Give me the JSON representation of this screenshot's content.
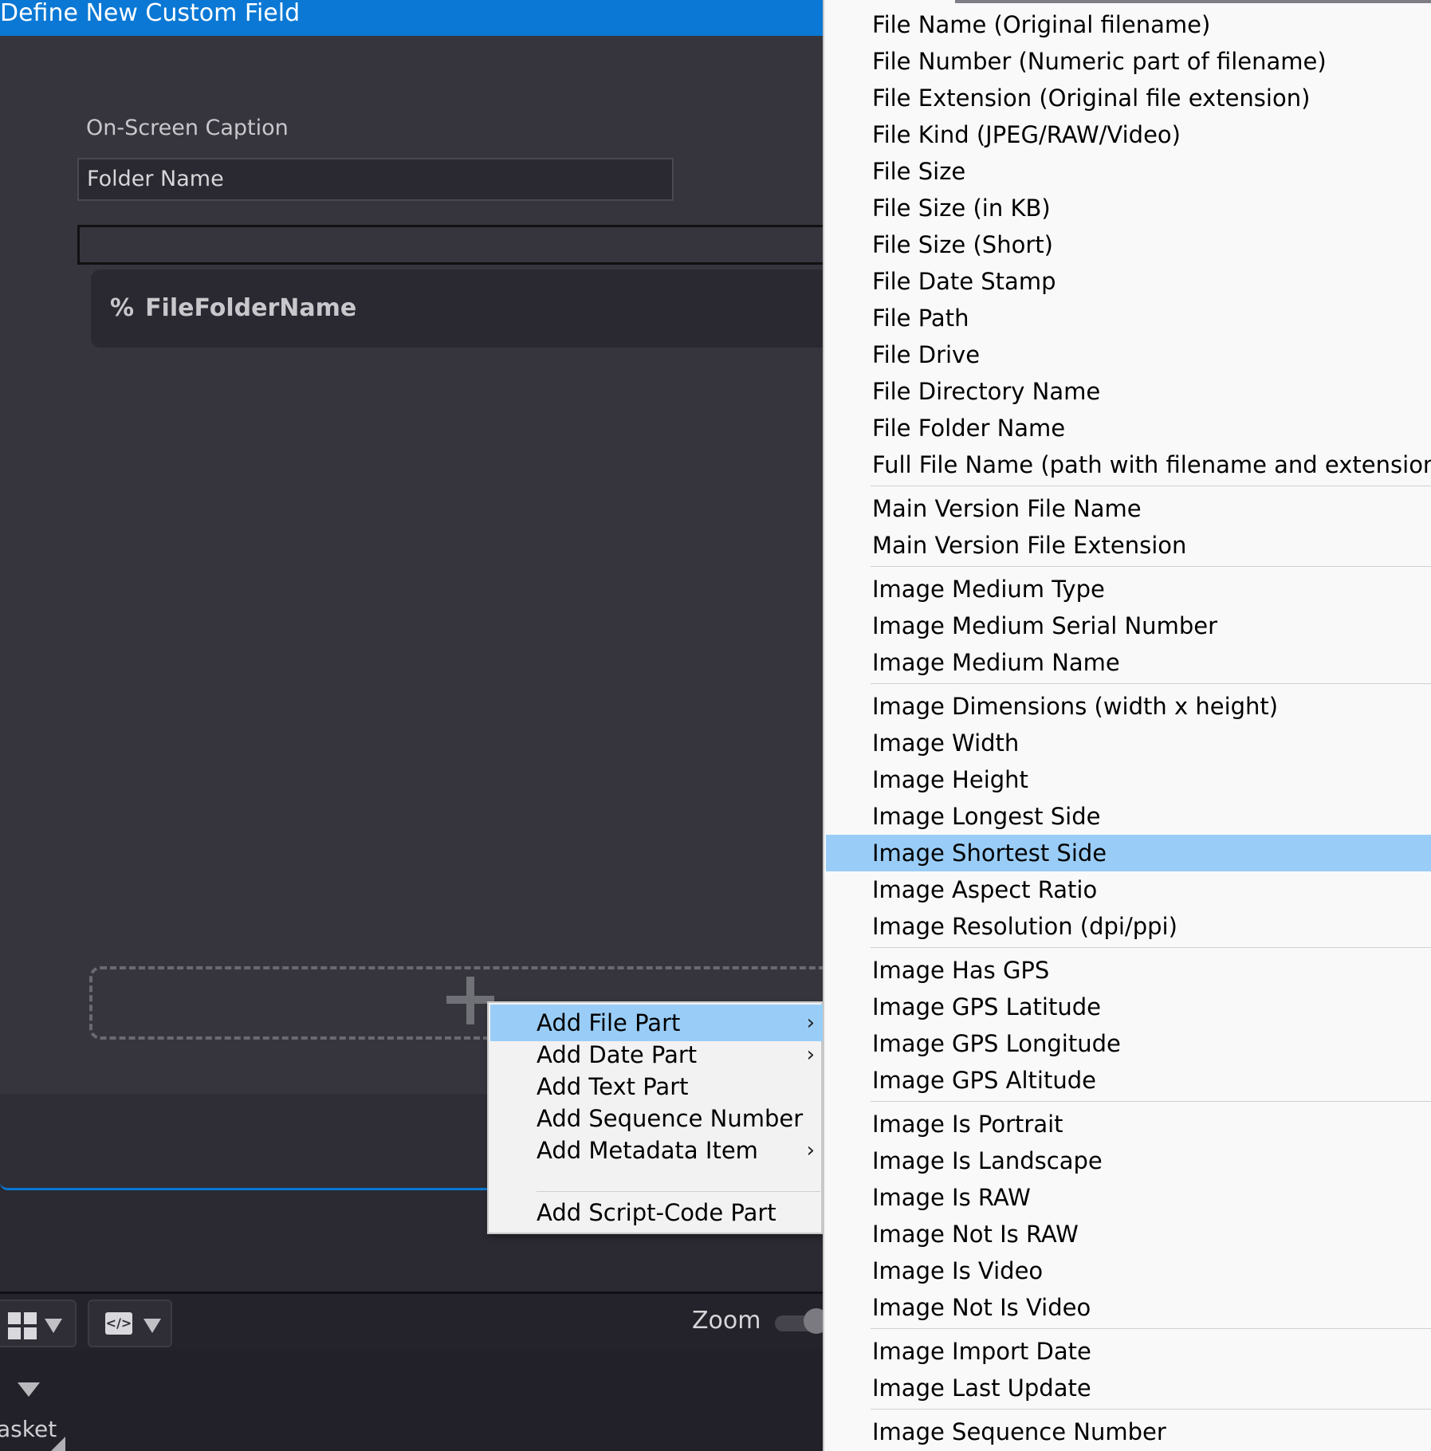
{
  "window": {
    "title": "Define New Custom Field"
  },
  "dialog": {
    "caption_label": "On-Screen Caption",
    "caption_value": "Folder Name",
    "expression_value": "",
    "part": {
      "symbol": "%",
      "name": "FileFolderName"
    }
  },
  "context_menu": {
    "items": [
      {
        "label": "Add File Part",
        "submenu": true,
        "highlighted": true
      },
      {
        "label": "Add Date Part",
        "submenu": true
      },
      {
        "label": "Add Text Part",
        "submenu": false
      },
      {
        "label": "Add Sequence Number",
        "submenu": false
      },
      {
        "label": "Add Metadata Item",
        "submenu": true
      },
      {
        "label": "Add Script-Code Part",
        "submenu": false
      }
    ],
    "arrow_glyph": "›"
  },
  "submenu": {
    "items": [
      "File Name (Original filename)",
      "File Number (Numeric part of filename)",
      "File Extension (Original file extension)",
      "File Kind (JPEG/RAW/Video)",
      "File Size",
      "File Size (in KB)",
      "File Size (Short)",
      "File Date Stamp",
      "File Path",
      "File Drive",
      "File Directory Name",
      "File Folder Name",
      "Full File Name (path with filename and extension)",
      "Main Version File Name",
      "Main Version File Extension",
      "Image Medium Type",
      "Image Medium Serial Number",
      "Image Medium Name",
      "Image Dimensions (width x height)",
      "Image Width",
      "Image Height",
      "Image Longest Side",
      "Image Shortest Side",
      "Image Aspect Ratio",
      "Image Resolution (dpi/ppi)",
      "Image Has GPS",
      "Image GPS Latitude",
      "Image GPS Longitude",
      "Image GPS Altitude",
      "Image Is Portrait",
      "Image Is Landscape",
      "Image Is RAW",
      "Image Not Is RAW",
      "Image Is Video",
      "Image Not Is Video",
      "Image Import Date",
      "Image Last Update",
      "Image Sequence Number"
    ],
    "highlighted": "Image Shortest Side"
  },
  "toolbar": {
    "layout_icon": "grid-icon",
    "code_icon": "code-icon",
    "code_glyph": "</>",
    "zoom_label": "Zoom"
  },
  "bottom": {
    "basket_label": "asket"
  },
  "colors": {
    "accent": "#0a78d4",
    "highlight": "#99cdf7",
    "panel": "#36353e"
  }
}
